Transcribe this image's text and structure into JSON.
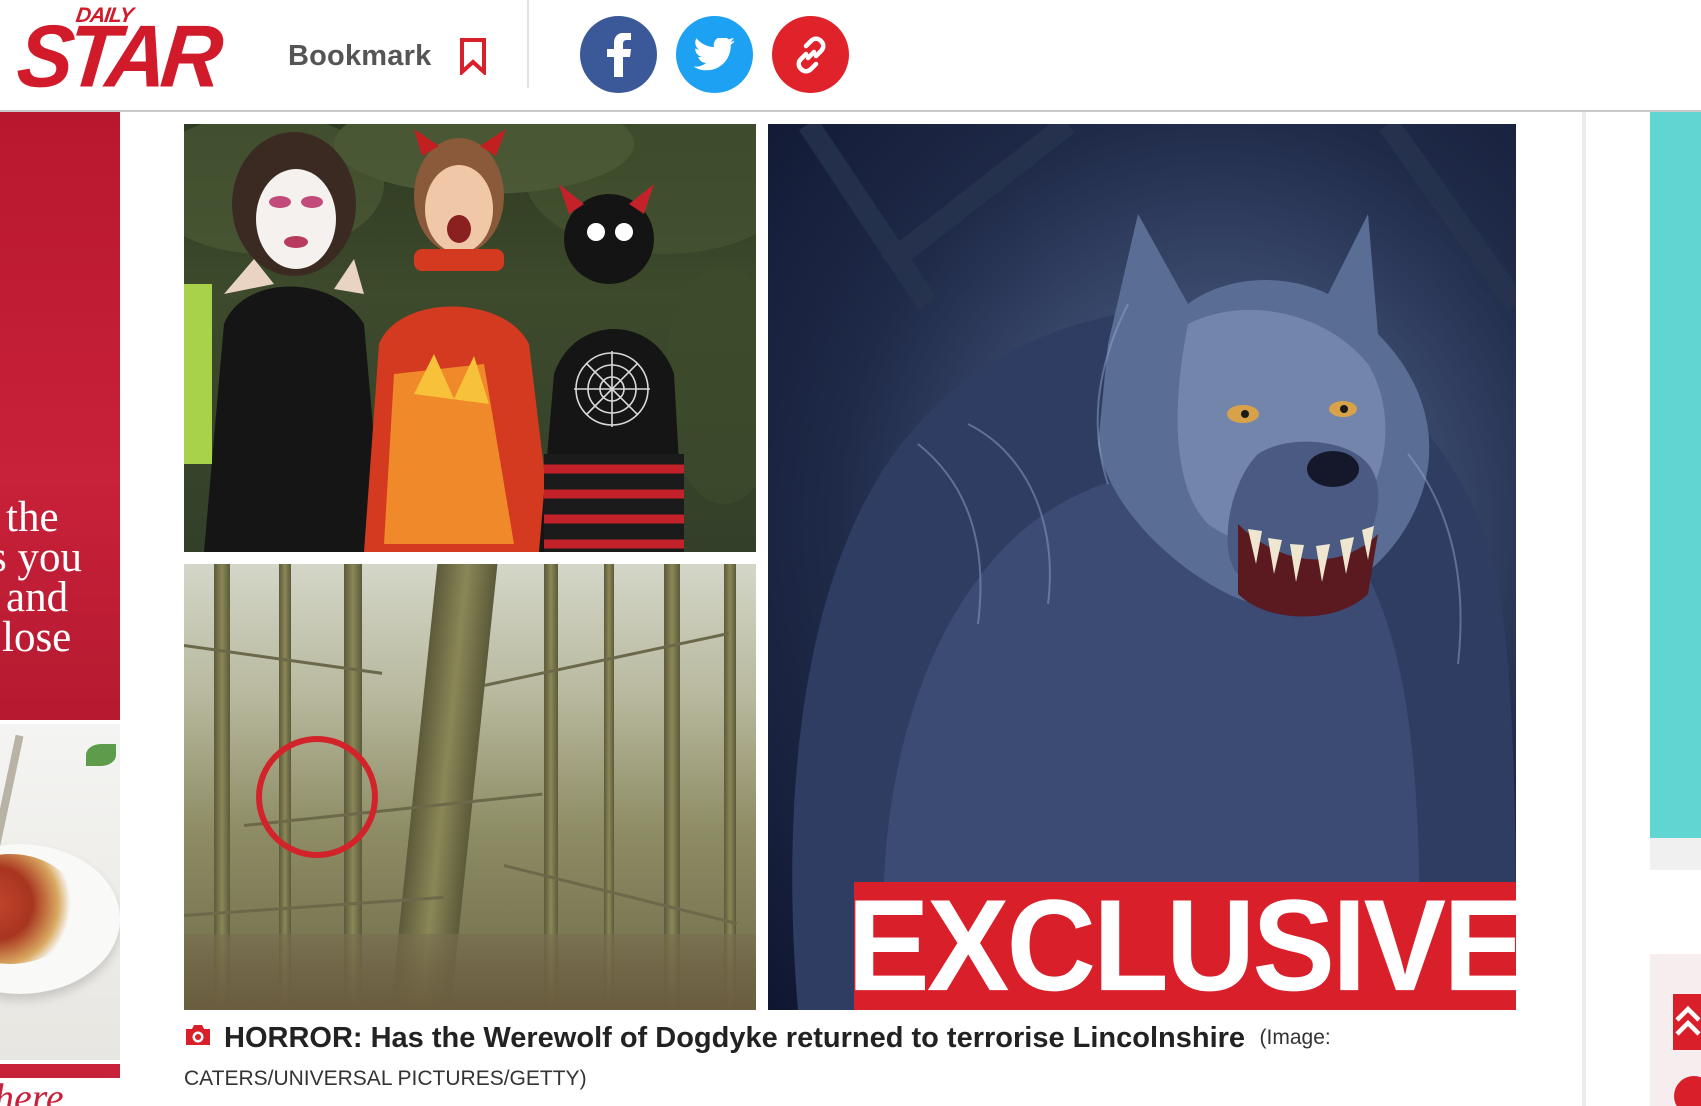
{
  "header": {
    "logo_small": "DAILY",
    "logo_big": "STAR",
    "bookmark_label": "Bookmark",
    "bookmark_icon": "bookmark-icon",
    "share": [
      {
        "name": "facebook",
        "icon": "facebook-icon",
        "color": "#3b5998"
      },
      {
        "name": "twitter",
        "icon": "twitter-icon",
        "color": "#1da1f2"
      },
      {
        "name": "copy-link",
        "icon": "link-icon",
        "color": "#e0222b"
      }
    ]
  },
  "left_ad": {
    "lines": [
      "the",
      "s you",
      "and",
      "lose"
    ],
    "script_text": "here"
  },
  "image": {
    "badge_text": "EXCLUSIVE",
    "badge_color": "#d91f2a",
    "circle_color": "#d2232a"
  },
  "caption": {
    "icon": "camera-icon",
    "title": "HORROR: Has the Werewolf of Dogdyke returned to terrorise Lincolnshire",
    "credit_prefix": "(Image:",
    "credit": "CATERS/UNIVERSAL PICTURES/GETTY)"
  },
  "colors": {
    "brand_red": "#d11b2b",
    "right_ad_teal": "#5fd6d2"
  }
}
